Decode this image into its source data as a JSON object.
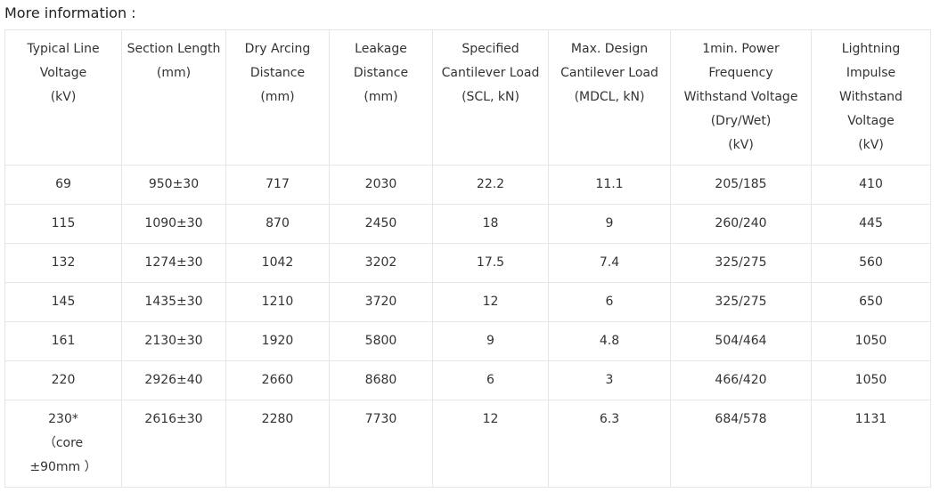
{
  "section_title": "More information :",
  "table": {
    "headers": [
      [
        "Typical Line",
        "Voltage",
        "(kV)"
      ],
      [
        "Section Length",
        "(mm)"
      ],
      [
        "Dry Arcing",
        "Distance",
        "(mm)"
      ],
      [
        "Leakage",
        "Distance",
        "(mm)"
      ],
      [
        "Specified",
        "Cantilever Load",
        "(SCL, kN)"
      ],
      [
        "Max. Design",
        "Cantilever Load",
        "(MDCL, kN)"
      ],
      [
        "1min. Power",
        "Frequency",
        "Withstand Voltage",
        "(Dry/Wet)",
        "(kV)"
      ],
      [
        "Lightning",
        "Impulse",
        "Withstand",
        "Voltage",
        "(kV)"
      ]
    ],
    "rows": [
      [
        [
          "69"
        ],
        [
          "950±30"
        ],
        [
          "717"
        ],
        [
          "2030"
        ],
        [
          "22.2"
        ],
        [
          "11.1"
        ],
        [
          "205/185"
        ],
        [
          "410"
        ]
      ],
      [
        [
          "115"
        ],
        [
          "1090±30"
        ],
        [
          "870"
        ],
        [
          "2450"
        ],
        [
          "18"
        ],
        [
          "9"
        ],
        [
          "260/240"
        ],
        [
          "445"
        ]
      ],
      [
        [
          "132"
        ],
        [
          "1274±30"
        ],
        [
          "1042"
        ],
        [
          "3202"
        ],
        [
          "17.5"
        ],
        [
          "7.4"
        ],
        [
          "325/275"
        ],
        [
          "560"
        ]
      ],
      [
        [
          "145"
        ],
        [
          "1435±30"
        ],
        [
          "1210"
        ],
        [
          "3720"
        ],
        [
          "12"
        ],
        [
          "6"
        ],
        [
          "325/275"
        ],
        [
          "650"
        ]
      ],
      [
        [
          "161"
        ],
        [
          "2130±30"
        ],
        [
          "1920"
        ],
        [
          "5800"
        ],
        [
          "9"
        ],
        [
          "4.8"
        ],
        [
          "504/464"
        ],
        [
          "1050"
        ]
      ],
      [
        [
          "220"
        ],
        [
          "2926±40"
        ],
        [
          "2660"
        ],
        [
          "8680"
        ],
        [
          "6"
        ],
        [
          "3"
        ],
        [
          "466/420"
        ],
        [
          "1050"
        ]
      ],
      [
        [
          "230*",
          "（core",
          "±90mm ）"
        ],
        [
          "2616±30"
        ],
        [
          "2280"
        ],
        [
          "7730"
        ],
        [
          "12"
        ],
        [
          "6.3"
        ],
        [
          "684/578"
        ],
        [
          "1131"
        ]
      ]
    ]
  }
}
